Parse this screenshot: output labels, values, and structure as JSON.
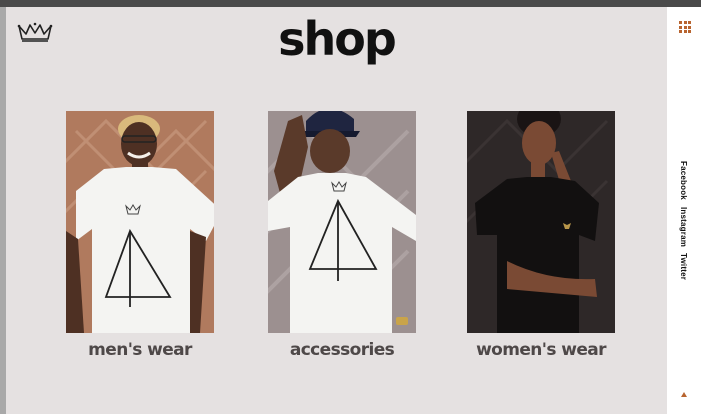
{
  "page": {
    "title": "shop",
    "logo_icon": "crown-icon",
    "colors": {
      "accent": "#b8642f",
      "background": "#e5e1e1",
      "text": "#111111",
      "label": "#4e4848"
    }
  },
  "categories": [
    {
      "label": "men's wear",
      "icon": "photo-man-white-tee"
    },
    {
      "label": "accessories",
      "icon": "photo-man-cap-white-tee"
    },
    {
      "label": "women's wear",
      "icon": "photo-woman-black-tee"
    }
  ],
  "rail": {
    "menu_icon": "grid-icon",
    "social": [
      "Facebook",
      "Instagram",
      "Twitter"
    ],
    "scroll_icon": "arrow-up-icon"
  }
}
